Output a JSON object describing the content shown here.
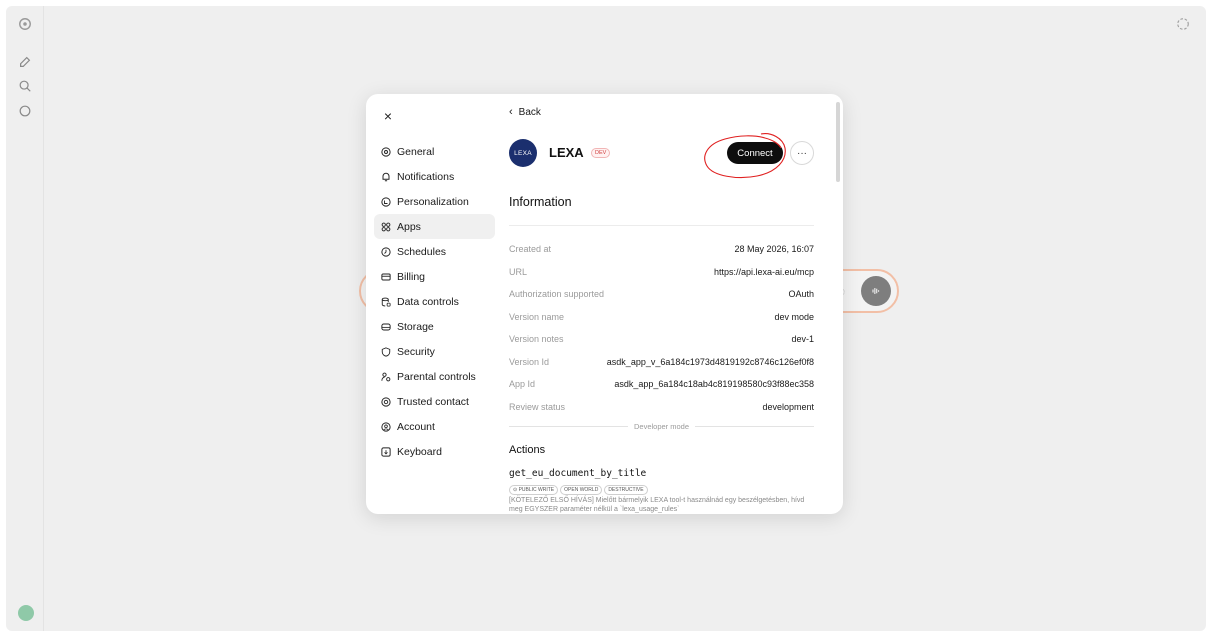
{
  "nav": {
    "close_label": "×",
    "items": [
      {
        "label": "General",
        "icon": "gear-icon"
      },
      {
        "label": "Notifications",
        "icon": "bell-icon"
      },
      {
        "label": "Personalization",
        "icon": "personalization-icon"
      },
      {
        "label": "Apps",
        "icon": "apps-icon",
        "active": true
      },
      {
        "label": "Schedules",
        "icon": "clock-icon"
      },
      {
        "label": "Billing",
        "icon": "credit-card-icon"
      },
      {
        "label": "Data controls",
        "icon": "database-icon"
      },
      {
        "label": "Storage",
        "icon": "storage-icon"
      },
      {
        "label": "Security",
        "icon": "shield-icon"
      },
      {
        "label": "Parental controls",
        "icon": "parental-icon"
      },
      {
        "label": "Trusted contact",
        "icon": "lifebuoy-icon"
      },
      {
        "label": "Account",
        "icon": "account-icon"
      },
      {
        "label": "Keyboard",
        "icon": "keyboard-icon"
      }
    ]
  },
  "content": {
    "back_label": "Back",
    "app": {
      "logo_text": "LEXA",
      "name": "LEXA",
      "badge": "DEV",
      "connect_label": "Connect",
      "more_label": "···"
    },
    "info_title": "Information",
    "info_rows": [
      {
        "key": "Created at",
        "value": "28 May 2026, 16:07"
      },
      {
        "key": "URL",
        "value": "https://api.lexa-ai.eu/mcp"
      },
      {
        "key": "Authorization supported",
        "value": "OAuth"
      },
      {
        "key": "Version name",
        "value": "dev mode"
      },
      {
        "key": "Version notes",
        "value": "dev-1"
      },
      {
        "key": "Version Id",
        "value": "asdk_app_v_6a184c1973d4819192c8746c126ef0f8"
      },
      {
        "key": "App Id",
        "value": "asdk_app_6a184c18ab4c819198580c93f88ec358"
      },
      {
        "key": "Review status",
        "value": "development"
      }
    ],
    "developer_mode_label": "Developer mode",
    "actions_title": "Actions",
    "action": {
      "name": "get_eu_document_by_title",
      "tags": [
        "⊙ PUBLIC WRITE",
        "OPEN WORLD",
        "DESTRUCTIVE"
      ],
      "description": "[KÖTELEZŐ ELSŐ HÍVÁS] Mielőtt bármelyik LEXA tool-t használnád egy beszélgetésben, hívd meg EGYSZER paraméter nélkül a `lexa_usage_rules`"
    }
  },
  "colors": {
    "accent_annotation": "#e02020",
    "connect_bg": "#0d0d0d",
    "logo_bg": "#1b2f6e",
    "input_border": "#f2bfa6"
  }
}
